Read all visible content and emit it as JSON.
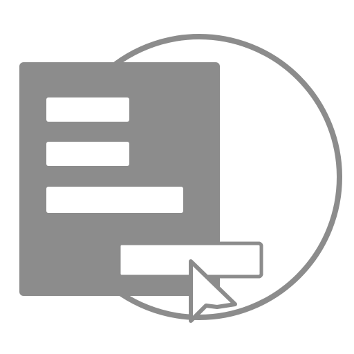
{
  "icon": {
    "name": "form-submit-icon",
    "colors": {
      "stroke": "#8c8c8c",
      "fill": "#8c8c8c",
      "background": "#ffffff"
    },
    "parts": [
      "circle-outline",
      "form-document",
      "form-field-lines",
      "submit-button",
      "cursor-pointer"
    ]
  }
}
